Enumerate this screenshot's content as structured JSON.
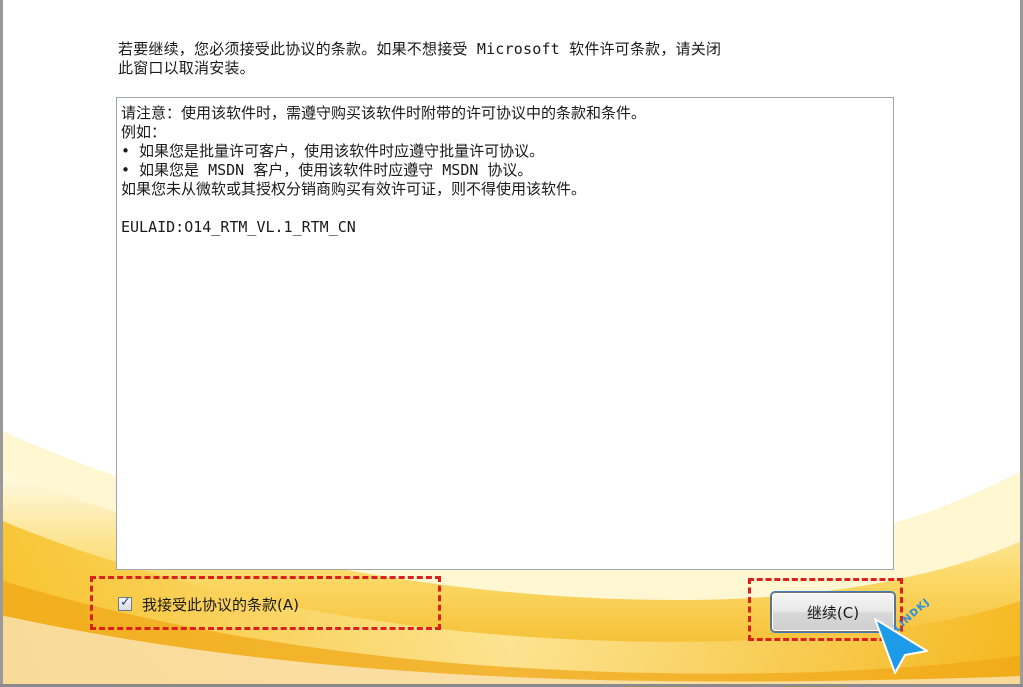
{
  "instruction": {
    "line1": "若要继续，您必须接受此协议的条款。如果不想接受 Microsoft 软件许可条款，请关闭",
    "line2": "此窗口以取消安装。"
  },
  "eula": {
    "lines": [
      "请注意：使用该软件时，需遵守购买该软件时附带的许可协议中的条款和条件。",
      "例如：",
      "• 如果您是批量许可客户，使用该软件时应遵守批量许可协议。",
      "• 如果您是 MSDN 客户，使用该软件时应遵守 MSDN 协议。",
      "如果您未从微软或其授权分销商购买有效许可证，则不得使用该软件。"
    ],
    "eula_id": "EULAID:O14_RTM_VL.1_RTM_CN"
  },
  "accept": {
    "checked": true,
    "check_glyph": "✓",
    "label": "我接受此协议的条款(A)"
  },
  "continue_button": {
    "label": "继续(C)"
  },
  "watermark": {
    "text": "LINDKJ"
  },
  "colors": {
    "highlight": "#d9211f",
    "cursor": "#1e9be8",
    "swoosh": "#f7c22c"
  },
  "icons": {
    "cursor": "arrow-cursor-icon",
    "checkbox": "checkmark-icon"
  }
}
